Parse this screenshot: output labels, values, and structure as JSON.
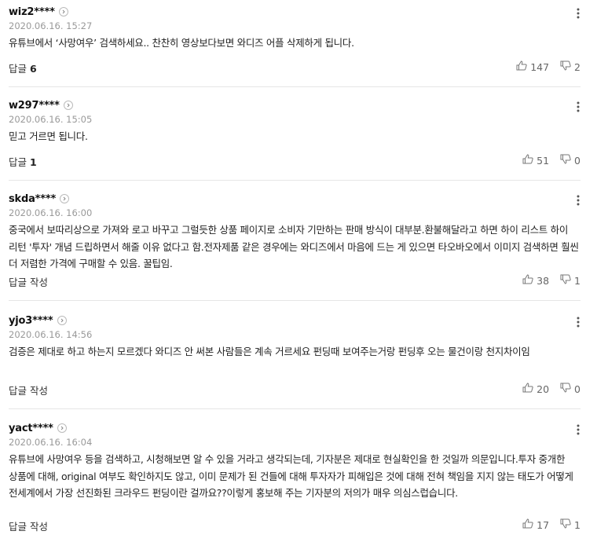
{
  "comments": [
    {
      "author": "wiz2****",
      "date": "2020.06.16. 15:27",
      "text": "유튜브에서 ‘사망여우’ 검색하세요.. 찬찬히 영상보다보면 와디즈 어플 삭제하게 됩니다.",
      "reply_label": "답글",
      "reply_count": "6",
      "likes": "147",
      "dislikes": "2"
    },
    {
      "author": "w297****",
      "date": "2020.06.16. 15:05",
      "text": "믿고 거르면 됩니다.",
      "reply_label": "답글",
      "reply_count": "1",
      "likes": "51",
      "dislikes": "0"
    },
    {
      "author": "skda****",
      "date": "2020.06.16. 16:00",
      "text": "중국에서 보따리상으로 가져와 로고 바꾸고 그럴듯한 상품 페이지로 소비자 기만하는 판매 방식이 대부분.환불해달라고 하면 하이 리스트 하이 리턴 '투자' 개념 드립하면서 해줄 이유 없다고 함.전자제품 같은 경우에는 와디즈에서 마음에 드는 게 있으면 타오바오에서 이미지 검색하면 훨씬 더 저렴한 가격에 구매할 수 있음. 꿀팁임.",
      "reply_label": "답글 작성",
      "reply_count": "",
      "likes": "38",
      "dislikes": "1"
    },
    {
      "author": "yjo3****",
      "date": "2020.06.16. 14:56",
      "text": "검증은 제대로 하고 하는지 모르겠다 와디즈 안 써본 사람들은 계속 거르세요 펀딩때 보여주는거랑 펀딩후 오는 물건이랑 천지차이임",
      "reply_label": "답글 작성",
      "reply_count": "",
      "likes": "20",
      "dislikes": "0"
    },
    {
      "author": "yact****",
      "date": "2020.06.16. 16:04",
      "text": "유튜브에 사망여우 등을 검색하고, 시청해보면 알 수 있을 거라고 생각되는데, 기자분은 제대로 현실확인을 한 것일까 의문입니다.투자 중개한 상품에 대해, original 여부도 확인하지도 않고, 이미 문제가 된 건들에 대해 투자자가 피해입은 것에 대해 전혀 책임을 지지 않는 태도가 어떻게 전세계에서 가장 선진화된 크라우드 펀딩이란 걸까요??이렇게 홍보해 주는 기자분의 저의가 매우 의심스럽습니다.",
      "reply_label": "답글 작성",
      "reply_count": "",
      "likes": "17",
      "dislikes": "1"
    }
  ],
  "icons": {
    "profile": "chevron-right-icon",
    "more": "more-vertical-icon",
    "like": "thumbs-up-icon",
    "dislike": "thumbs-down-icon"
  }
}
